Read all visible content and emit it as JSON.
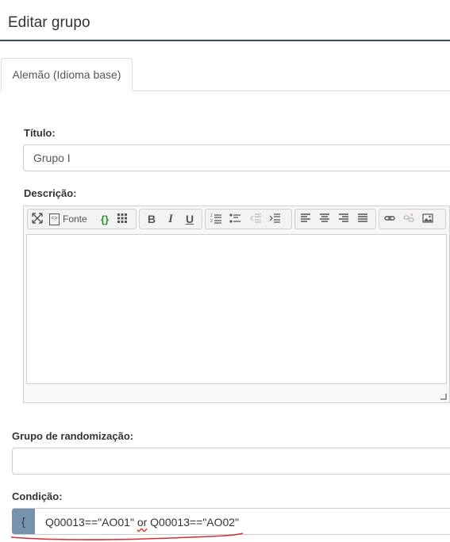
{
  "header": {
    "title": "Editar grupo"
  },
  "tabs": [
    {
      "label": "Alemão (Idioma base)",
      "active": true
    }
  ],
  "form": {
    "titulo_label": "Título:",
    "titulo_value": "Grupo I",
    "descricao_label": "Descrição:",
    "randomizacao_label": "Grupo de randomização:",
    "randomizacao_value": "",
    "condicao_label": "Condição:",
    "condicao_brace": "{",
    "condicao_part1": "Q00013==\"AO01\" ",
    "condicao_or": "or",
    "condicao_part2": " Q00013==\"AO02\""
  },
  "toolbar": {
    "source_label": "Fonte",
    "bold": "B",
    "italic": "I",
    "underline": "U"
  },
  "colors": {
    "accent_rule": "#2f4f5f",
    "brace_bg": "#7692ad",
    "annotation": "#d32f2f"
  }
}
